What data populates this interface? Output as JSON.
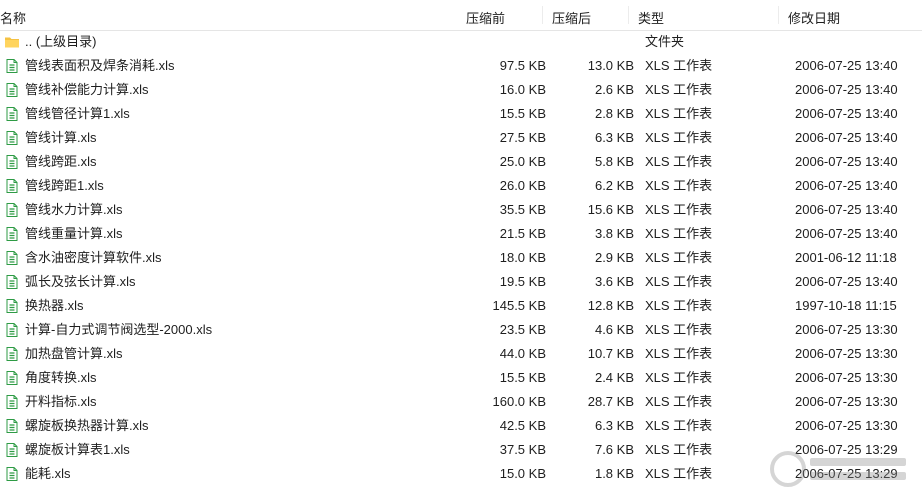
{
  "columns": {
    "name": "名称",
    "size_before": "压缩前",
    "size_after": "压缩后",
    "type": "类型",
    "modified": "修改日期"
  },
  "parent": {
    "name": ".. (上级目录)",
    "type": "文件夹",
    "icon": "folder-icon",
    "color": "#f5c242"
  },
  "file_icon": {
    "icon": "excel-file-icon",
    "color": "#2e9b45"
  },
  "files": [
    {
      "name": "管线表面积及焊条消耗.xls",
      "before": "97.5 KB",
      "after": "13.0 KB",
      "type": "XLS 工作表",
      "date": "2006-07-25 13:40"
    },
    {
      "name": "管线补偿能力计算.xls",
      "before": "16.0 KB",
      "after": "2.6 KB",
      "type": "XLS 工作表",
      "date": "2006-07-25 13:40"
    },
    {
      "name": "管线管径计算1.xls",
      "before": "15.5 KB",
      "after": "2.8 KB",
      "type": "XLS 工作表",
      "date": "2006-07-25 13:40"
    },
    {
      "name": "管线计算.xls",
      "before": "27.5 KB",
      "after": "6.3 KB",
      "type": "XLS 工作表",
      "date": "2006-07-25 13:40"
    },
    {
      "name": "管线跨距.xls",
      "before": "25.0 KB",
      "after": "5.8 KB",
      "type": "XLS 工作表",
      "date": "2006-07-25 13:40"
    },
    {
      "name": "管线跨距1.xls",
      "before": "26.0 KB",
      "after": "6.2 KB",
      "type": "XLS 工作表",
      "date": "2006-07-25 13:40"
    },
    {
      "name": "管线水力计算.xls",
      "before": "35.5 KB",
      "after": "15.6 KB",
      "type": "XLS 工作表",
      "date": "2006-07-25 13:40"
    },
    {
      "name": "管线重量计算.xls",
      "before": "21.5 KB",
      "after": "3.8 KB",
      "type": "XLS 工作表",
      "date": "2006-07-25 13:40"
    },
    {
      "name": "含水油密度计算软件.xls",
      "before": "18.0 KB",
      "after": "2.9 KB",
      "type": "XLS 工作表",
      "date": "2001-06-12 11:18"
    },
    {
      "name": "弧长及弦长计算.xls",
      "before": "19.5 KB",
      "after": "3.6 KB",
      "type": "XLS 工作表",
      "date": "2006-07-25 13:40"
    },
    {
      "name": "换热器.xls",
      "before": "145.5 KB",
      "after": "12.8 KB",
      "type": "XLS 工作表",
      "date": "1997-10-18 11:15"
    },
    {
      "name": "计算-自力式调节阀选型-2000.xls",
      "before": "23.5 KB",
      "after": "4.6 KB",
      "type": "XLS 工作表",
      "date": "2006-07-25 13:30"
    },
    {
      "name": "加热盘管计算.xls",
      "before": "44.0 KB",
      "after": "10.7 KB",
      "type": "XLS 工作表",
      "date": "2006-07-25 13:30"
    },
    {
      "name": "角度转换.xls",
      "before": "15.5 KB",
      "after": "2.4 KB",
      "type": "XLS 工作表",
      "date": "2006-07-25 13:30"
    },
    {
      "name": "开料指标.xls",
      "before": "160.0 KB",
      "after": "28.7 KB",
      "type": "XLS 工作表",
      "date": "2006-07-25 13:30"
    },
    {
      "name": "螺旋板换热器计算.xls",
      "before": "42.5 KB",
      "after": "6.3 KB",
      "type": "XLS 工作表",
      "date": "2006-07-25 13:30"
    },
    {
      "name": "螺旋板计算表1.xls",
      "before": "37.5 KB",
      "after": "7.6 KB",
      "type": "XLS 工作表",
      "date": "2006-07-25 13:29"
    },
    {
      "name": "能耗.xls",
      "before": "15.0 KB",
      "after": "1.8 KB",
      "type": "XLS 工作表",
      "date": "2006-07-25 13:29"
    }
  ]
}
